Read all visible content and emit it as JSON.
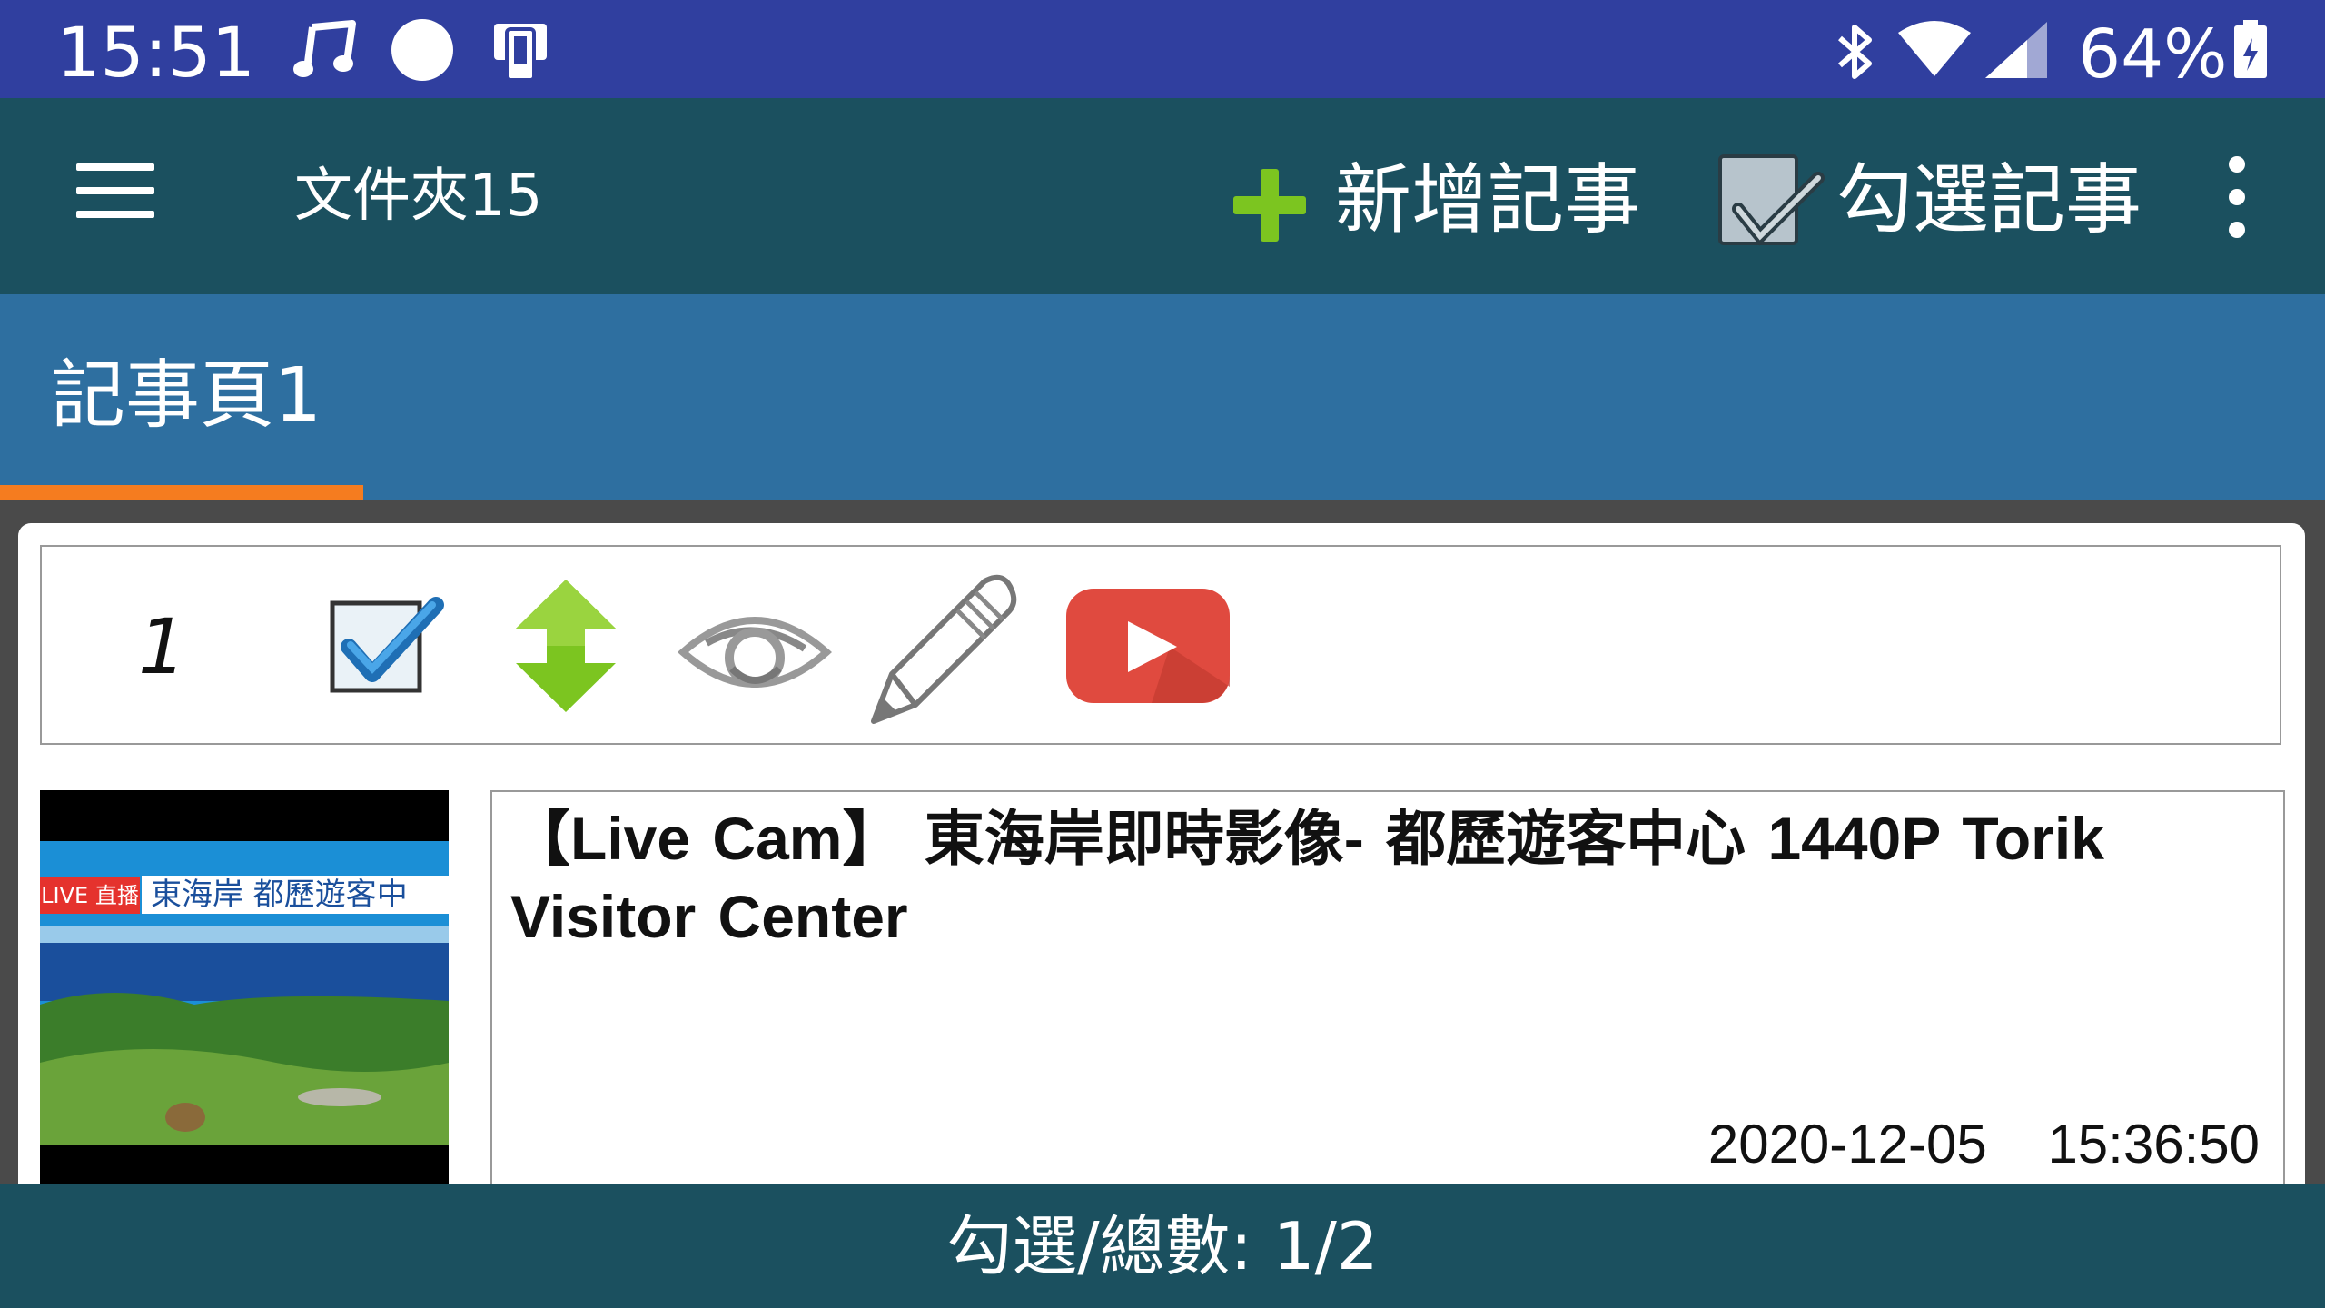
{
  "status_bar": {
    "time": "15:51",
    "battery_percent": "64%",
    "icons": [
      "music-note-icon",
      "circle-notification-icon",
      "device-icon",
      "bluetooth-icon",
      "wifi-icon",
      "cell-signal-icon",
      "battery-charging-icon"
    ]
  },
  "app_bar": {
    "title": "文件夾15",
    "add_note_label": "新增記事",
    "select_notes_label": "勾選記事",
    "icons": [
      "menu-icon",
      "plus-icon",
      "checkbox-icon",
      "overflow-menu-icon"
    ]
  },
  "tabs": [
    {
      "label": "記事頁1",
      "selected": true
    }
  ],
  "note": {
    "index": "1",
    "checked": true,
    "toolbar_icons": [
      "checkbox-checked-icon",
      "move-updown-icon",
      "view-eye-icon",
      "edit-pencil-icon",
      "youtube-play-icon"
    ],
    "thumbnail": {
      "live_badge": "LIVE 直播",
      "caption": "東海岸 都歷遊客中"
    },
    "title": "【Live Cam】 東海岸即時影像- 都歷遊客中心  1440P  Torik Visitor Center",
    "date": "2020-12-05",
    "time": "15:36:50"
  },
  "bottom_bar": {
    "selection_text": "勾選/總數: 1/2"
  },
  "colors": {
    "status_bar": "#303f9f",
    "app_bar": "#1b505f",
    "tab_bar": "#2e6fa0",
    "tab_indicator": "#f57c1f",
    "add_green": "#7cc520",
    "youtube_red": "#e04a3f"
  }
}
